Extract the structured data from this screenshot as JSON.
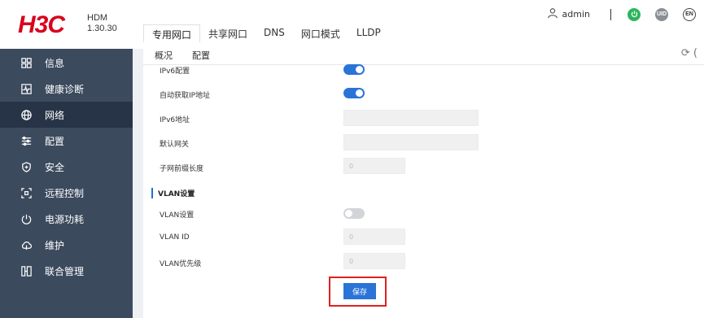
{
  "brand": {
    "logo": "H3C",
    "product": "HDM",
    "version": "1.30.30"
  },
  "header": {
    "username": "admin",
    "uid_label": "UID",
    "lang_label": "EN"
  },
  "tabs": [
    {
      "label": "专用网口"
    },
    {
      "label": "共享网口"
    },
    {
      "label": "DNS"
    },
    {
      "label": "网口模式"
    },
    {
      "label": "LLDP"
    }
  ],
  "subtabs": [
    {
      "label": "概况"
    },
    {
      "label": "配置"
    }
  ],
  "nav": [
    {
      "label": "信息",
      "icon": "grid-icon"
    },
    {
      "label": "健康诊断",
      "icon": "pulse-icon"
    },
    {
      "label": "网络",
      "icon": "globe-icon"
    },
    {
      "label": "配置",
      "icon": "sliders-icon"
    },
    {
      "label": "安全",
      "icon": "shield-icon"
    },
    {
      "label": "远程控制",
      "icon": "remote-icon"
    },
    {
      "label": "电源功耗",
      "icon": "power-icon"
    },
    {
      "label": "维护",
      "icon": "cloud-icon"
    },
    {
      "label": "联合管理",
      "icon": "federation-icon"
    }
  ],
  "form": {
    "ipv6_config_label": "IPv6配置",
    "auto_ip_label": "自动获取IP地址",
    "ipv6_address_label": "IPv6地址",
    "ipv6_address_value": "",
    "gateway_label": "默认网关",
    "gateway_value": "",
    "prefix_label": "子网前缀长度",
    "prefix_value": "0",
    "vlan_section_title": "VLAN设置",
    "vlan_setting_label": "VLAN设置",
    "vlan_id_label": "VLAN ID",
    "vlan_id_value": "0",
    "vlan_priority_label": "VLAN优先级",
    "vlan_priority_value": "0",
    "save_label": "保存"
  },
  "colors": {
    "accent": "#2a74d8",
    "sidebar": "#3c4a5e",
    "highlight": "#e02020",
    "power": "#2db55d"
  }
}
